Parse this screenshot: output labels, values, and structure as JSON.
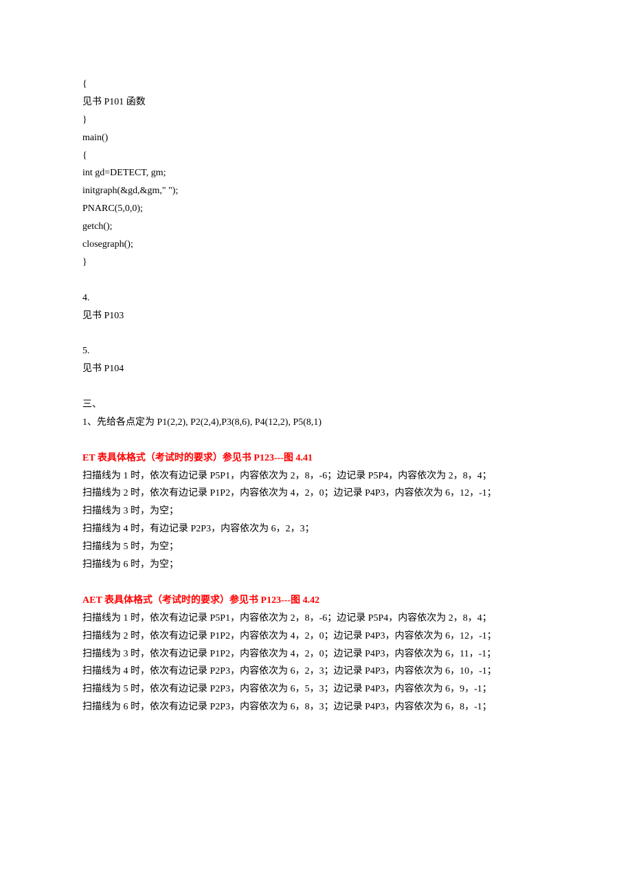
{
  "code": {
    "l1": "{",
    "l2": "见书 P101 函数",
    "l3": "}",
    "l4": "main()",
    "l5": "{",
    "l6": "int gd=DETECT, gm;",
    "l7": "initgraph(&gd,&gm,\" \");",
    "l8": "PNARC(5,0,0);",
    "l9": "getch();",
    "l10": "closegraph();",
    "l11": "}"
  },
  "sec4": {
    "num": "4.",
    "ref": "见书 P103"
  },
  "sec5": {
    "num": "5.",
    "ref": "见书 P104"
  },
  "sec3": {
    "head": "三、",
    "item1": "1、先给各点定为  P1(2,2), P2(2,4),P3(8,6), P4(12,2), P5(8,1)"
  },
  "et": {
    "title": "ET 表具体格式（考试时的要求）参见书 P123---图 4.41",
    "l1": "扫描线为 1 时，依次有边记录 P5P1，内容依次为 2，8，-6；边记录 P5P4，内容依次为 2，8，4；",
    "l2": "扫描线为 2 时，依次有边记录 P1P2，内容依次为 4，2，0；边记录 P4P3，内容依次为 6，12，-1；",
    "l3": "扫描线为 3 时，为空；",
    "l4": "扫描线为 4 时，有边记录 P2P3，内容依次为 6，2，3；",
    "l5": "扫描线为 5 时，为空；",
    "l6": "扫描线为 6 时，为空；"
  },
  "aet": {
    "title": "AET 表具体格式（考试时的要求）参见书 P123---图 4.42",
    "l1": "扫描线为 1 时，依次有边记录 P5P1，内容依次为 2，8，-6；边记录 P5P4，内容依次为 2，8，4；",
    "l2": "扫描线为 2 时，依次有边记录 P1P2，内容依次为 4，2，0；边记录 P4P3，内容依次为 6，12，-1；",
    "l3": "扫描线为 3 时，依次有边记录 P1P2，内容依次为 4，2，0；边记录 P4P3，内容依次为 6，11，-1；",
    "l4": "扫描线为 4 时，依次有边记录 P2P3，内容依次为 6，2，3；边记录 P4P3，内容依次为 6，10，-1；",
    "l5": "扫描线为 5 时，依次有边记录 P2P3，内容依次为 6，5，3；边记录 P4P3，内容依次为 6，9，-1；",
    "l6": "扫描线为 6 时，依次有边记录 P2P3，内容依次为 6，8，3；边记录 P4P3，内容依次为 6，8，-1；"
  }
}
